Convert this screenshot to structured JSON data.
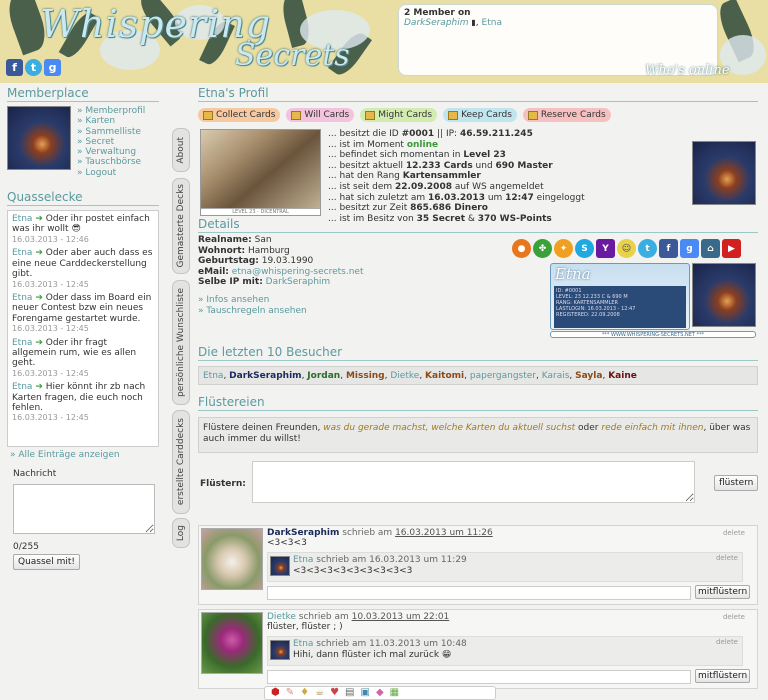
{
  "header": {
    "logo_line1": "Whispering",
    "logo_line2": "Secrets",
    "whos_online": "Who's online",
    "online_count": "2 Member on",
    "online_members": [
      "DarkSeraphim",
      "Etna"
    ],
    "online_sep": ", "
  },
  "social": {
    "f": "f",
    "t": "t",
    "g": "g"
  },
  "memberplace": {
    "title": "Memberplace",
    "links": [
      "» Memberprofil",
      "» Karten",
      "» Sammelliste",
      "» Secret",
      "» Verwaltung",
      "» Tauschbörse",
      "» Logout"
    ]
  },
  "quasselecke": {
    "title": "Quasselecke",
    "entries": [
      {
        "user": "Etna",
        "text": "Oder ihr postet einfach was ihr wollt",
        "date": "16.03.2013 - 12:46"
      },
      {
        "user": "Etna",
        "text": "Oder aber auch dass es eine neue Carddeckerstellung gibt.",
        "date": "16.03.2013 - 12:45"
      },
      {
        "user": "Etna",
        "text": "Oder dass im Board ein neuer Contest bzw ein neues Forengame gestartet wurde.",
        "date": "16.03.2013 - 12:45"
      },
      {
        "user": "Etna",
        "text": "Oder ihr fragt allgemein rum, wie es allen geht.",
        "date": "16.03.2013 - 12:45"
      },
      {
        "user": "Etna",
        "text": "Hier könnt ihr zb nach Karten fragen, die euch noch fehlen.",
        "date": "16.03.2013 - 12:45"
      }
    ],
    "all_link": "» Alle Einträge anzeigen",
    "message_label": "Nachricht",
    "counter": "0/255",
    "submit": "Quassel mit!"
  },
  "vtabs": [
    "About",
    "Gemasterte Decks",
    "persönliche Wunschliste",
    "erstellte Carddecks",
    "Log"
  ],
  "profile": {
    "title": "Etna's Profil",
    "card_tabs": [
      "Collect Cards",
      "Will Cards",
      "Might Cards",
      "Keep Cards",
      "Reserve Cards"
    ],
    "card_tab_colors": [
      "#f7c9a0",
      "#f3c2dd",
      "#d2ecb0",
      "#bfe5ee",
      "#f7c0c0"
    ],
    "pic_caption": "LEVEL 23 - DICENTRAL",
    "facts": {
      "f1a": "... besitzt die ID ",
      "f1b": "#0001",
      "f1c": " || IP: ",
      "f1d": "46.59.211.245",
      "f2a": "... ist im Moment ",
      "f2b": "online",
      "f3a": "... befindet sich momentan in ",
      "f3b": "Level 23",
      "f4a": "... besitzt aktuell ",
      "f4b": "12.233 Cards",
      "f4c": " und ",
      "f4d": "690 Master",
      "f5a": "... hat den Rang ",
      "f5b": "Kartensammler",
      "f6a": "... ist seit dem ",
      "f6b": "22.09.2008",
      "f6c": " auf WS angemeldet",
      "f7a": "... hat sich zuletzt am ",
      "f7b": "16.03.2013",
      "f7c": " um ",
      "f7d": "12:47",
      "f7e": " eingeloggt",
      "f8a": "... besitzt zur Zeit ",
      "f8b": "865.686 Dinero",
      "f9a": "... ist im Besitz von ",
      "f9b": "35 Secret",
      "f9c": " & ",
      "f9d": "370 WS-Points"
    }
  },
  "details": {
    "title": "Details",
    "realname_label": "Realname:",
    "realname": "San",
    "wohnort_label": "Wohnort:",
    "wohnort": "Hamburg",
    "geburtstag_label": "Geburtstag:",
    "geburtstag": "19.03.1990",
    "email_label": "eMail:",
    "email": "etna@whispering-secrets.net",
    "selbe_label": "Selbe IP mit:",
    "selbe": "DarkSeraphim",
    "infos_link": "» Infos ansehen",
    "tausch_link": "» Tauschregeln ansehen",
    "badge_name": "Etna",
    "badge_lines": [
      "ID: #0001",
      "LEVEL: 23  12.233 C & 690 M",
      "RANG: KARTENSAMMLER",
      "LASTLOGIN: 16.03.2013 - 12:47",
      "REGISTERED: 22.09.2008"
    ],
    "badge_url": "*** WWW.WHISPERING-SECRETS.NET ***",
    "icons": [
      "firefox-icon",
      "clover-icon",
      "butterfly-icon",
      "skype-icon",
      "yahoo-icon",
      "lol-icon",
      "twitter-icon",
      "facebook-icon",
      "google-icon",
      "lastfm-icon",
      "youtube-icon"
    ]
  },
  "visitors": {
    "title": "Die letzten 10 Besucher",
    "list": [
      {
        "name": "Etna",
        "color": "#5a9aa0",
        "bold": false
      },
      {
        "name": "DarkSeraphim",
        "color": "#1a2a5a",
        "bold": true
      },
      {
        "name": "Jordan",
        "color": "#2a6a2a",
        "bold": true
      },
      {
        "name": "Missing",
        "color": "#8a4a1a",
        "bold": true
      },
      {
        "name": "Dietke",
        "color": "#5a9aa0",
        "bold": false
      },
      {
        "name": "Kaitomi",
        "color": "#8a4a1a",
        "bold": true
      },
      {
        "name": "papergangster",
        "color": "#5a9aa0",
        "bold": false
      },
      {
        "name": "Karais",
        "color": "#5a9aa0",
        "bold": false
      },
      {
        "name": "Sayla",
        "color": "#8a4a1a",
        "bold": true
      },
      {
        "name": "Kaine",
        "color": "#6a1010",
        "bold": true
      }
    ]
  },
  "fluestereien": {
    "title": "Flüstereien",
    "intro_a": "Flüstere deinen Freunden, ",
    "intro_b": "was du gerade machst, welche Karten du aktuell suchst",
    "intro_c": " oder ",
    "intro_d": "rede einfach mit ihnen",
    "intro_e": ", über was auch immer du willst!",
    "label": "Flüstern:",
    "button": "flüstern",
    "posts": [
      {
        "user": "DarkSeraphim",
        "wrote": " schrieb am ",
        "date": "16.03.2013 um 11:26",
        "text": "<3<3<3",
        "delete": "delete",
        "reply": {
          "user": "Etna",
          "wrote": " schrieb am ",
          "date": "16.03.2013 um 11:29",
          "text": "<3<3<3<3<3<3<3<3<3",
          "delete": "delete"
        },
        "reply_button": "mitflüstern"
      },
      {
        "user": "Dietke",
        "wrote": " schrieb am ",
        "date": "10.03.2013 um 22:01",
        "text": "flüster, flüster ; )",
        "delete": "delete",
        "reply": {
          "user": "Etna",
          "wrote": " schrieb am ",
          "date": "11.03.2013 um 10:48",
          "text": "Hihi, dann flüster ich mal zurück",
          "delete": "delete"
        },
        "reply_button": "mitflüstern"
      }
    ]
  }
}
